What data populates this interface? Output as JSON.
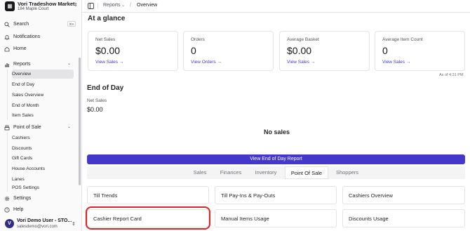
{
  "store": {
    "name": "Vori Tradeshow Market",
    "address": "184 Maple Court"
  },
  "sidebar": {
    "search_label": "Search",
    "search_shortcut": "⌘K",
    "notifications_label": "Notifications",
    "home_label": "Home",
    "reports_label": "Reports",
    "reports_items": [
      "Overview",
      "End of Day",
      "Sales Overview",
      "End of Month",
      "Item Sales"
    ],
    "pos_label": "Point of Sale",
    "pos_items": [
      "Cashiers",
      "Discounts",
      "Gift Cards",
      "House Accounts",
      "Lanes",
      "POS Settings"
    ],
    "settings_label": "Settings",
    "help_label": "Help"
  },
  "user": {
    "initial": "V",
    "name": "Vori Demo User - STO...",
    "email": "salesdemo@vori.com"
  },
  "topbar": {
    "crumb1": "Reports",
    "crumb2": "Overview"
  },
  "glance": {
    "heading": "At a glance",
    "cards": [
      {
        "label": "Net Sales",
        "value": "$0.00",
        "link": "View Sales →"
      },
      {
        "label": "Orders",
        "value": "0",
        "link": "View Orders →"
      },
      {
        "label": "Average Basket",
        "value": "$0.00",
        "link": "View Sales →"
      },
      {
        "label": "Average Item Count",
        "value": "0",
        "link": "View Sales →"
      }
    ],
    "as_of": "As of 4:31 PM"
  },
  "eod": {
    "heading": "End of Day",
    "net_sales_label": "Net Sales",
    "net_sales_value": "$0.00",
    "empty_text": "No sales",
    "view_button": "View End of Day Report"
  },
  "tabs": [
    "Sales",
    "Finances",
    "Inventory",
    "Point Of Sale",
    "Shoppers"
  ],
  "active_tab": "Point Of Sale",
  "reports": [
    "Till Trends",
    "Till Pay-Ins & Pay-Outs",
    "Cashiers Overview",
    "Cashier Report Card",
    "Manual Items Usage",
    "Discounts Usage"
  ],
  "colors": {
    "accent": "#4338ca",
    "highlight": "#e02424"
  }
}
